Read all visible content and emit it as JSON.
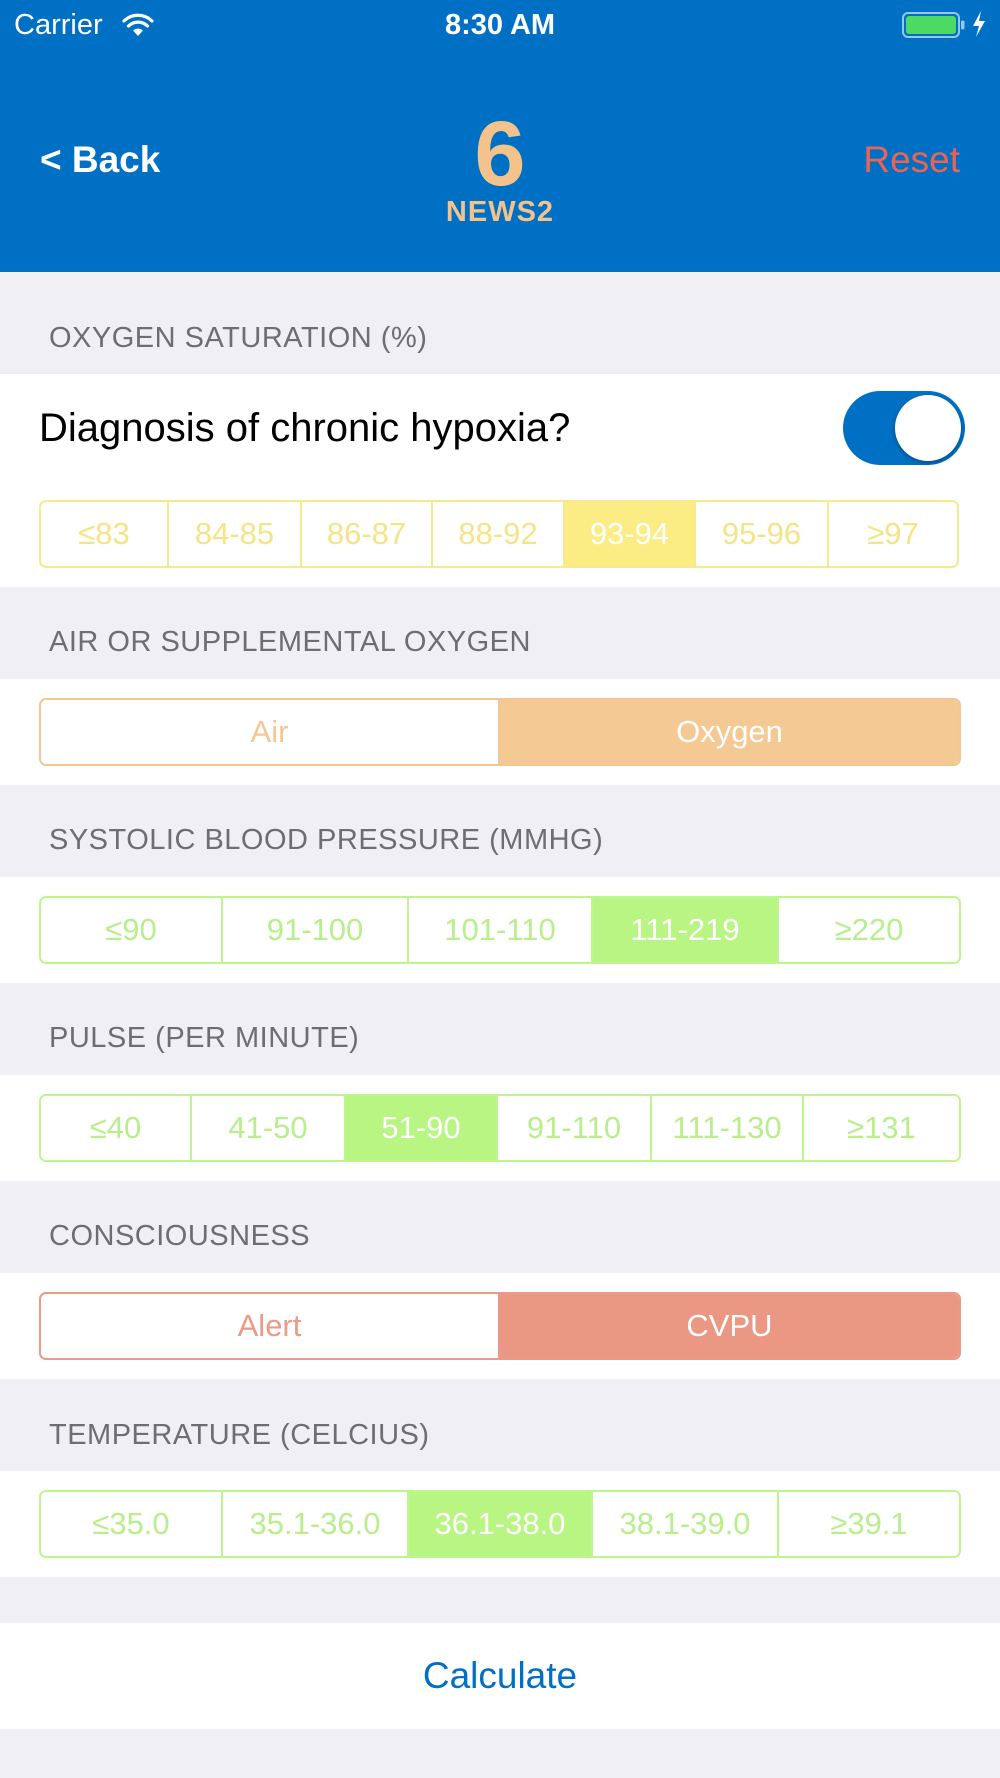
{
  "status_bar": {
    "carrier": "Carrier",
    "time": "8:30 AM"
  },
  "header": {
    "back_label": "< Back",
    "score": "6",
    "score_label": "NEWS2",
    "reset_label": "Reset"
  },
  "sections": {
    "oxygen_saturation": {
      "title": "OXYGEN SATURATION (%)",
      "toggle_label": "Diagnosis of chronic hypoxia?",
      "toggle_on": true,
      "options": [
        "≤83",
        "84-85",
        "86-87",
        "88-92",
        "93-94",
        "95-96",
        "≥97"
      ],
      "selected": "93-94"
    },
    "air_oxygen": {
      "title": "AIR OR SUPPLEMENTAL OXYGEN",
      "options": [
        "Air",
        "Oxygen"
      ],
      "selected": "Oxygen"
    },
    "systolic_bp": {
      "title": "SYSTOLIC BLOOD PRESSURE (MMHG)",
      "options": [
        "≤90",
        "91-100",
        "101-110",
        "111-219",
        "≥220"
      ],
      "selected": "111-219"
    },
    "pulse": {
      "title": "PULSE (PER MINUTE)",
      "options": [
        "≤40",
        "41-50",
        "51-90",
        "91-110",
        "111-130",
        "≥131"
      ],
      "selected": "51-90"
    },
    "consciousness": {
      "title": "CONSCIOUSNESS",
      "options": [
        "Alert",
        "CVPU"
      ],
      "selected": "CVPU"
    },
    "temperature": {
      "title": "TEMPERATURE (CELCIUS)",
      "options": [
        "≤35.0",
        "35.1-36.0",
        "36.1-38.0",
        "38.1-39.0",
        "≥39.1"
      ],
      "selected": "36.1-38.0"
    }
  },
  "calculate_label": "Calculate",
  "colors": {
    "header_bg": "#0070c4",
    "score": "#f3c38b",
    "reset": "#eb6453",
    "yellow_selected": "#fbec84",
    "orange_selected": "#f5c994",
    "green_selected": "#b9f582",
    "red_selected": "#ea9883"
  },
  "icons": [
    "wifi-icon",
    "battery-icon",
    "charging-bolt-icon"
  ]
}
